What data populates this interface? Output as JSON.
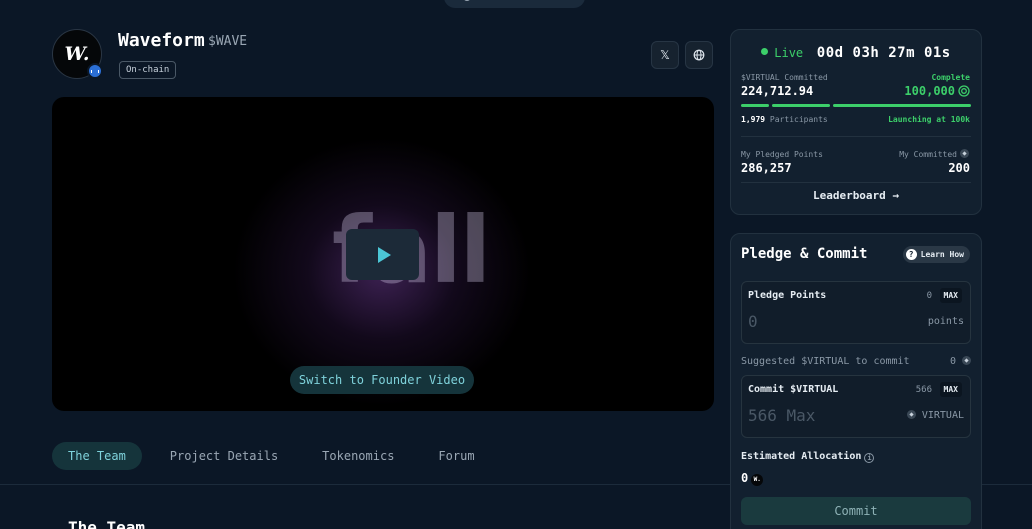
{
  "project": {
    "name": "Waveform",
    "ticker": "$WAVE",
    "tag": "On-chain",
    "logo_text": "W."
  },
  "social": {
    "x_label": "𝕏",
    "web_icon": "globe-icon"
  },
  "video": {
    "overlay_text": "fall",
    "switch_label": "Switch to Founder Video"
  },
  "tabs": [
    {
      "label": "The Team",
      "active": true
    },
    {
      "label": "Project Details",
      "active": false
    },
    {
      "label": "Tokenomics",
      "active": false
    },
    {
      "label": "Forum",
      "active": false
    }
  ],
  "section_title": "The Team",
  "status": {
    "live_label": "Live",
    "countdown": "00d 03h 27m 01s",
    "committed_label": "$VIRTUAL Committed",
    "committed_value": "224,712.94",
    "complete_label": "Complete",
    "complete_value": "100,000",
    "participants_count": "1,979",
    "participants_label": "Participants",
    "launching_label": "Launching at 100k",
    "pledged_label": "My Pledged Points",
    "pledged_value": "286,257",
    "my_committed_label": "My Committed",
    "my_committed_value": "200",
    "leaderboard_label": "Leaderboard →"
  },
  "pledge": {
    "title": "Pledge & Commit",
    "learn_label": "Learn How",
    "points_label": "Pledge Points",
    "points_available": "0",
    "max_label": "MAX",
    "points_value": "0",
    "points_unit": "points",
    "suggest_label": "Suggested $VIRTUAL to commit",
    "suggest_value": "0",
    "commit_label": "Commit $VIRTUAL",
    "commit_available": "566",
    "commit_placeholder": "566 Max",
    "commit_unit": "VIRTUAL",
    "estimated_label": "Estimated Allocation",
    "estimated_value": "0",
    "commit_button": "Commit"
  },
  "colors": {
    "accent_green": "#3ccf6a",
    "accent_teal": "#7fd2db",
    "background": "#0b1726"
  }
}
